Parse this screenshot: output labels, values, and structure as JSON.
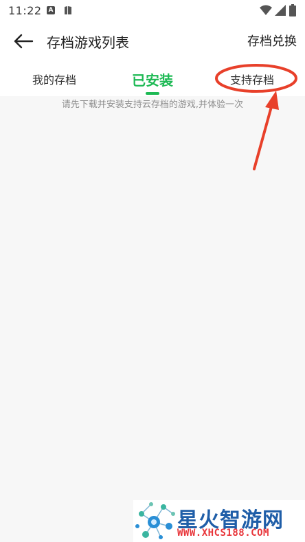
{
  "status_bar": {
    "time": "11:22",
    "icons": [
      "a-notification-icon",
      "book-icon",
      "wifi-icon",
      "signal-icon",
      "battery-icon"
    ]
  },
  "header": {
    "back_icon": "arrow-left-icon",
    "title": "存档游戏列表",
    "exchange_label": "存档兑换"
  },
  "tabs": [
    {
      "label": "我的存档",
      "active": false
    },
    {
      "label": "已安装",
      "active": true
    },
    {
      "label": "支持存档",
      "active": false
    }
  ],
  "empty_message": "请先下载并安装支持云存档的游戏,并体验一次",
  "colors": {
    "accent": "#1db954",
    "annotation": "#e8402a",
    "background": "#f7f7f7"
  },
  "watermark": {
    "brand": "星火智游网",
    "url": "WWW.XHCS188.COM"
  }
}
